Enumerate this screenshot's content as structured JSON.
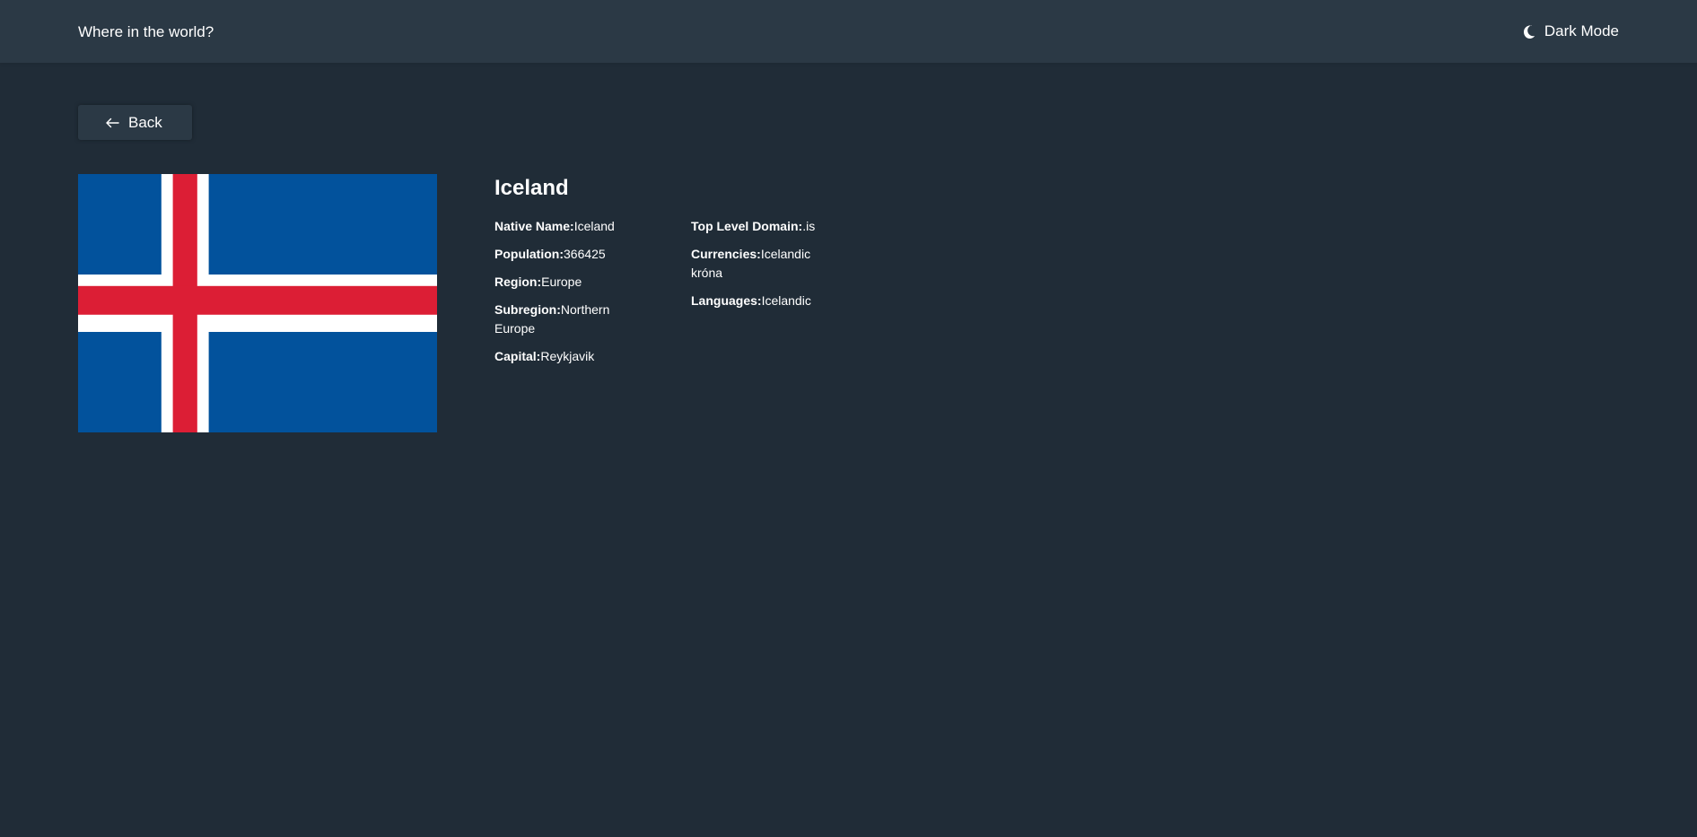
{
  "header": {
    "title": "Where in the world?",
    "theme_toggle_label": "Dark Mode",
    "theme_icon": "moon-icon"
  },
  "back_button": {
    "label": "Back",
    "icon": "arrow-left-icon"
  },
  "country": {
    "name": "Iceland",
    "flag_colors": {
      "blue": "#02529C",
      "white": "#FFFFFF",
      "red": "#DC1E35"
    },
    "left_facts": [
      {
        "label": "Native Name:",
        "value": "Iceland"
      },
      {
        "label": "Population:",
        "value": "366425"
      },
      {
        "label": "Region:",
        "value": "Europe"
      },
      {
        "label": "Subregion:",
        "value": "Northern Europe"
      },
      {
        "label": "Capital:",
        "value": "Reykjavik"
      }
    ],
    "right_facts": [
      {
        "label": "Top Level Domain:",
        "value": ".is"
      },
      {
        "label": "Currencies:",
        "value": "Icelandic króna"
      },
      {
        "label": "Languages:",
        "value": "Icelandic"
      }
    ]
  },
  "colors": {
    "background": "#202c37",
    "surface": "#2b3945",
    "text": "#ffffff"
  }
}
